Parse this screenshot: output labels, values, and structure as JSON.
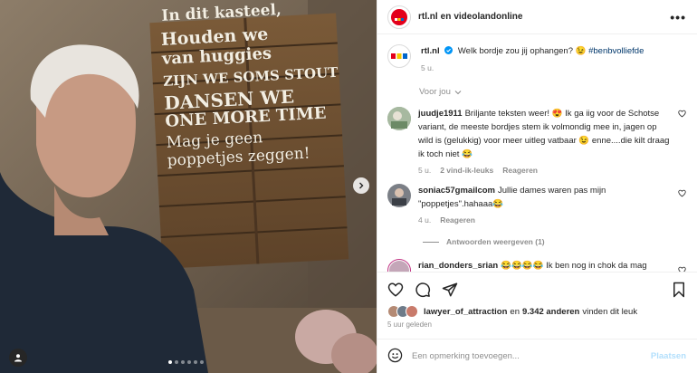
{
  "media": {
    "sign_lines": [
      "In dit kasteel,",
      "Houden we",
      "van huggies",
      "ZIJN WE SOMS STOUT",
      "DANSEN WE",
      "ONE MORE TIME",
      "Mag je geen",
      "poppetjes zeggen!"
    ],
    "carousel_total": 6,
    "carousel_active": 1
  },
  "header": {
    "username": "rtl.nl",
    "separator": "en",
    "collaborator": "videolandonline",
    "more_icon": "more-horizontal-icon"
  },
  "caption": {
    "username": "rtl.nl",
    "verified_icon": "verified-badge-icon",
    "text": "Welk bordje zou jij ophangen? 😉",
    "hashtag": "#benbvolliefde",
    "time": "5 u."
  },
  "sort": {
    "label": "Voor jou"
  },
  "comments": [
    {
      "username": "juudje1911",
      "text": "Briljante teksten weer! 😍 Ik ga iig voor de Schotse variant, de meeste bordjes stem ik volmondig mee in, jagen op wild is (gelukkig) voor meer uitleg vatbaar 😉 enne....die kilt draag ik toch niet 😂",
      "time": "5 u.",
      "likes": "2 vind-ik-leuks",
      "reply": "Reageren"
    },
    {
      "username": "soniac57gmailcom",
      "text": "Jullie dames waren pas mijn \"poppetjes\".hahaaa😂",
      "time": "4 u.",
      "reply": "Reageren"
    },
    {
      "username": "rian_donders_srian",
      "text": "😂😂😂😂 Ik ben nog in chok da mag"
    }
  ],
  "view_replies": "Antwoorden weergeven (1)",
  "likes": {
    "username": "lawyer_of_attraction",
    "connector": "en",
    "count": "9.342 anderen",
    "suffix": "vinden dit leuk"
  },
  "posted_time": "5 uur geleden",
  "composer": {
    "placeholder": "Een opmerking toevoegen...",
    "post_label": "Plaatsen"
  },
  "colors": {
    "link": "#00376b",
    "muted": "#8e8e8e",
    "verified": "#0095f6",
    "post_disabled": "#b2dffc",
    "brand_red": "#e3001b"
  }
}
